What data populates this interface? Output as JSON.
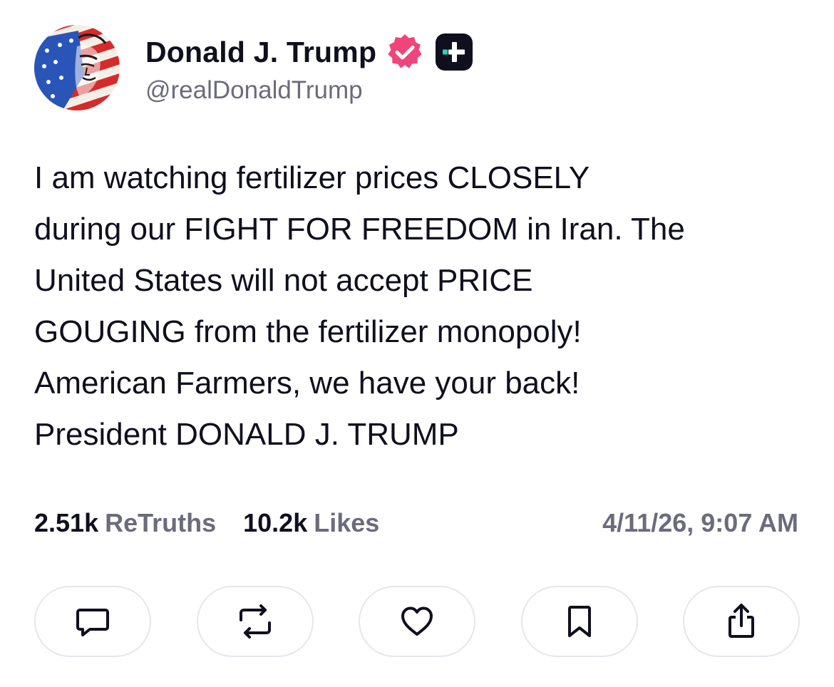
{
  "author": {
    "display_name": "Donald J. Trump",
    "handle": "@realDonaldTrump",
    "avatar_icon": "flag-portrait-avatar",
    "verified_icon": "verified-badge-icon",
    "plus_badge_icon": "truth-plus-badge-icon"
  },
  "post": {
    "text": "I am watching fertilizer prices CLOSELY\nduring our FIGHT FOR FREEDOM in Iran. The\nUnited States will not accept PRICE\nGOUGING from the fertilizer monopoly!\nAmerican Farmers, we have your back!\nPresident DONALD J. TRUMP"
  },
  "stats": {
    "retruths_count": "2.51k",
    "retruths_label": "ReTruths",
    "likes_count": "10.2k",
    "likes_label": "Likes",
    "timestamp": "4/11/26, 9:07 AM"
  },
  "actions": [
    {
      "name": "reply",
      "icon": "comment-icon"
    },
    {
      "name": "retruth",
      "icon": "repost-icon"
    },
    {
      "name": "like",
      "icon": "heart-icon"
    },
    {
      "name": "bookmark",
      "icon": "bookmark-icon"
    },
    {
      "name": "share",
      "icon": "share-icon"
    }
  ],
  "colors": {
    "text_primary": "#0f0f1e",
    "text_secondary": "#6b6b7c",
    "verified": "#f0457a",
    "plus_badge_bg": "#0f0f1e",
    "plus_badge_accent": "#2ed3b7",
    "button_border": "#e6e6ec"
  }
}
